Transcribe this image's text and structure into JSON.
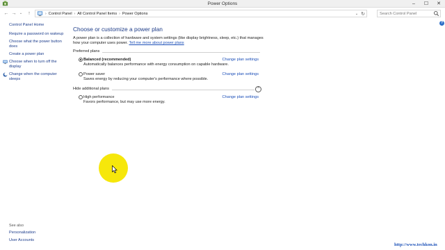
{
  "window": {
    "title": "Power Options",
    "controls": {
      "minimize": "–",
      "maximize": "☐",
      "close": "✕"
    }
  },
  "navigation": {
    "back": "←",
    "forward": "→",
    "history": "⌄",
    "up": "↑",
    "breadcrumbs": [
      "Control Panel",
      "All Control Panel Items",
      "Power Options"
    ],
    "crumb_separator": "›",
    "dropdown": "⌄",
    "refresh": "↻",
    "search_placeholder": "Search Control Panel"
  },
  "help": {
    "label": "?"
  },
  "sidebar": {
    "home": "Control Panel Home",
    "links": [
      "Require a password on wakeup",
      "Choose what the power button does",
      "Create a power plan",
      "Choose when to turn off the display",
      "Change when the computer sleeps"
    ],
    "see_also": {
      "title": "See also",
      "links": [
        "Personalization",
        "User Accounts"
      ]
    }
  },
  "main": {
    "heading": "Choose or customize a power plan",
    "description": "A power plan is a collection of hardware and system settings (like display brightness, sleep, etc.) that manages how your computer uses power.",
    "description_link": "Tell me more about power plans",
    "preferred_label": "Preferred plans",
    "hidden_label": "Hide additional plans",
    "collapse_glyph": "^",
    "change_link": "Change plan settings",
    "plans": [
      {
        "name": "Balanced (recommended)",
        "desc": "Automatically balances performance with energy consumption on capable hardware.",
        "selected": true
      },
      {
        "name": "Power saver",
        "desc": "Saves energy by reducing your computer's performance where possible.",
        "selected": false
      }
    ],
    "additional_plans": [
      {
        "name": "High performance",
        "desc": "Favors performance, but may use more energy.",
        "selected": false
      }
    ]
  },
  "watermark": "http://www.techkon.in",
  "colors": {
    "link": "#1c4fb8",
    "heading": "#1d3c88",
    "highlight": "#f6e70b"
  }
}
